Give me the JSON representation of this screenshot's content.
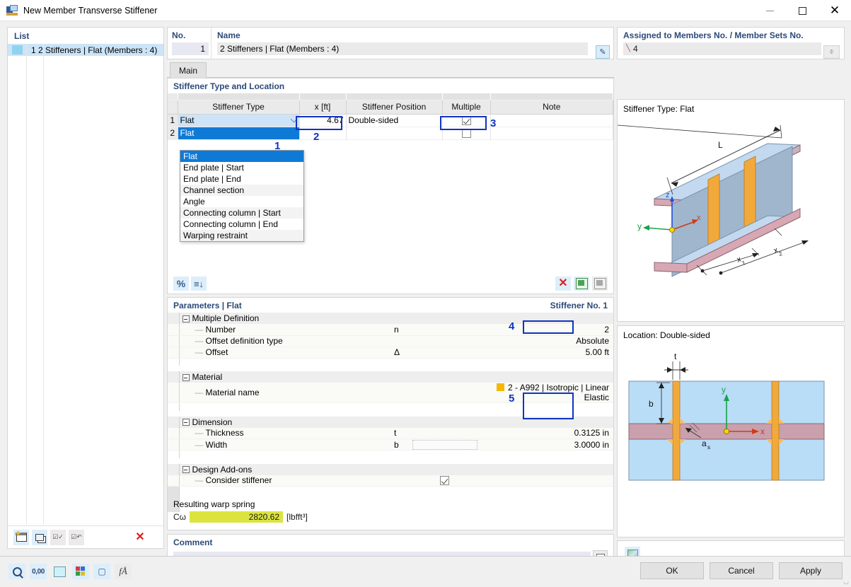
{
  "window": {
    "title": "New Member Transverse Stiffener",
    "minimize_label": "Minimize",
    "maximize_label": "Maximize",
    "close_label": "Close"
  },
  "list_panel": {
    "header": "List",
    "items": [
      {
        "index": "1",
        "label": "2 Stiffeners | Flat (Members : 4)"
      }
    ],
    "toolbar": [
      {
        "name": "new-item-button",
        "label": "New"
      },
      {
        "name": "copy-item-button",
        "label": "Copy"
      },
      {
        "name": "select-all-button",
        "label": "Select All"
      },
      {
        "name": "invert-selection-button",
        "label": "Invert Selection"
      },
      {
        "name": "delete-item-button",
        "label": "Delete"
      }
    ]
  },
  "header": {
    "no_label": "No.",
    "no_value": "1",
    "name_label": "Name",
    "name_value": "2 Stiffeners | Flat (Members : 4)",
    "name_edit_button": "Edit Name"
  },
  "tabs": [
    {
      "label": "Main",
      "active": true
    }
  ],
  "stiffener_section": {
    "title": "Stiffener Type and Location",
    "columns": [
      "Stiffener Type",
      "x [ft]",
      "Stiffener Position",
      "Multiple",
      "Note"
    ],
    "rows": [
      {
        "no": "1",
        "type": "Flat",
        "x": "4.67",
        "position": "Double-sided",
        "multiple": true,
        "note": ""
      },
      {
        "no": "2",
        "type": "Flat",
        "x": "",
        "position": "",
        "multiple": false,
        "note": ""
      }
    ],
    "dropdown": {
      "open": true,
      "selected": "Flat",
      "options": [
        "Flat",
        "End plate | Start",
        "End plate | End",
        "Channel section",
        "Angle",
        "Connecting column | Start",
        "Connecting column | End",
        "Warping restraint"
      ]
    },
    "toolbar": {
      "percent_label": "%",
      "sort_label": "Sort",
      "delete_label": "Delete Row",
      "export_excel_label": "Export to Excel",
      "import_excel_label": "Import from Excel"
    }
  },
  "parameters_section": {
    "title": "Parameters | Flat",
    "title_right": "Stiffener No. 1",
    "groups": [
      {
        "name": "Multiple Definition",
        "rows": [
          {
            "label": "Number",
            "symbol": "n",
            "value": "2",
            "unit": "",
            "editable": false
          },
          {
            "label": "Offset definition type",
            "symbol": "",
            "value": "Absolute",
            "unit": "",
            "editable": false
          },
          {
            "label": "Offset",
            "symbol": "Δ",
            "value": "5.00",
            "unit": "ft",
            "editable": true
          }
        ]
      },
      {
        "name": "Material",
        "rows": [
          {
            "label": "Material name",
            "symbol": "",
            "value": "2 - A992 | Isotropic | Linear Elastic",
            "unit": "",
            "swatch": "#f5b800",
            "editable": false
          }
        ]
      },
      {
        "name": "Dimension",
        "rows": [
          {
            "label": "Thickness",
            "symbol": "t",
            "value": "0.3125",
            "unit": "in",
            "editable": true
          },
          {
            "label": "Width",
            "symbol": "b",
            "value": "3.0000",
            "unit": "in",
            "editable": true
          }
        ]
      },
      {
        "name": "Design Add-ons",
        "rows": [
          {
            "label": "Consider stiffener",
            "symbol": "",
            "value": "",
            "unit": "",
            "checkbox": true,
            "checked": true
          }
        ]
      }
    ],
    "warp_spring": {
      "label": "Resulting warp spring",
      "symbol": "Cω",
      "value": "2820.62",
      "unit": "[lbfft³]"
    }
  },
  "comment_section": {
    "title": "Comment",
    "value": "",
    "placeholder": "",
    "button_label": "Comment Library"
  },
  "right_panel": {
    "assigned_label": "Assigned to Members No. / Member Sets No.",
    "assigned_value": "4",
    "assigned_pick_button": "Select Members",
    "stiffener_type_text": "Stiffener Type: Flat",
    "location_text": "Location: Double-sided",
    "image_button_label": "Show Image",
    "diagram_top": {
      "labels": [
        "L",
        "z",
        "y",
        "x",
        "x₁",
        "x₂"
      ]
    },
    "diagram_bottom": {
      "labels": [
        "t",
        "b",
        "y",
        "x",
        "aₛ"
      ]
    }
  },
  "annotations": [
    {
      "number": "1",
      "target": "stiffener-type-dropdown"
    },
    {
      "number": "2",
      "target": "x-position-cell"
    },
    {
      "number": "3",
      "target": "multiple-checkbox-cell"
    },
    {
      "number": "4",
      "target": "offset-value-field"
    },
    {
      "number": "5",
      "target": "thickness-width-fields"
    }
  ],
  "bottom_bar": {
    "tools": [
      {
        "name": "zoom-tool-button",
        "label": "Zoom"
      },
      {
        "name": "decimal-places-button",
        "label": "Decimal Places"
      },
      {
        "name": "background-color-button",
        "label": "Background Color"
      },
      {
        "name": "color-settings-button",
        "label": "Color Settings"
      },
      {
        "name": "render-settings-button",
        "label": "Render Settings"
      },
      {
        "name": "formula-button",
        "label": "Formula"
      }
    ],
    "buttons": [
      {
        "name": "ok-button",
        "label": "OK"
      },
      {
        "name": "cancel-button",
        "label": "Cancel"
      },
      {
        "name": "apply-button",
        "label": "Apply"
      }
    ]
  },
  "colors": {
    "accent": "#2c4a78",
    "annotation": "#1034c0",
    "selection": "#0f7ad6",
    "warp_highlight": "#dbe43f",
    "material_swatch": "#f5b800"
  }
}
